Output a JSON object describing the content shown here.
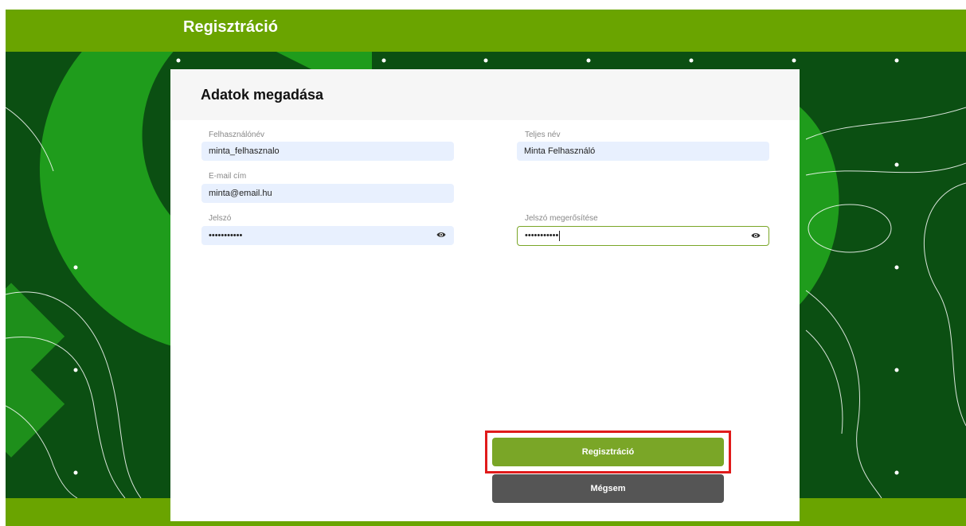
{
  "app": {
    "title": "Regisztráció"
  },
  "colors": {
    "brand": "#6aa400",
    "background": "#0b4f12",
    "primary_button": "#7aa627",
    "secondary_button": "#555555",
    "highlight": "#e01b1b"
  },
  "form": {
    "title": "Adatok megadása",
    "username": {
      "label": "Felhasználónév",
      "value": "minta_felhasznalo"
    },
    "full_name": {
      "label": "Teljes név",
      "value": "Minta Felhasználó"
    },
    "email": {
      "label": "E-mail cím",
      "value": "minta@email.hu"
    },
    "password": {
      "label": "Jelszó",
      "value": "•••••••••••",
      "icon": "eye-icon"
    },
    "password_confirm": {
      "label": "Jelszó megerősítése",
      "value": "•••••••••••",
      "icon": "eye-icon"
    }
  },
  "buttons": {
    "register": "Regisztráció",
    "cancel": "Mégsem"
  }
}
